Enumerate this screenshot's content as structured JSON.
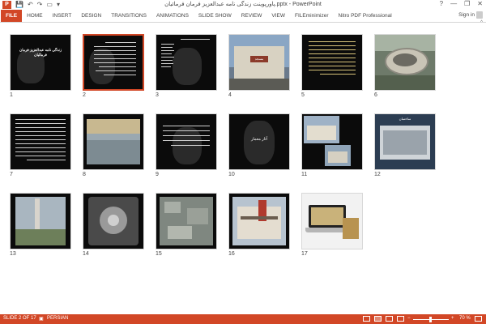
{
  "window": {
    "title": "پاورپوینت زندگی نامه عبدالعزیز فرمان فرمائیان.pptx - PowerPoint",
    "app_badge": "P",
    "qat": {
      "save": "💾",
      "undo": "↶",
      "redo": "↷",
      "start": "▭",
      "customize": "▾"
    },
    "help": "?",
    "minimize": "—",
    "restore": "❐",
    "close": "✕"
  },
  "ribbon": {
    "tabs": [
      "FILE",
      "HOME",
      "INSERT",
      "DESIGN",
      "TRANSITIONS",
      "ANIMATIONS",
      "SLIDE SHOW",
      "REVIEW",
      "VIEW",
      "FILEminimizer",
      "Nitro PDF Professional"
    ],
    "signin": "Sign in",
    "collapse": "^"
  },
  "slides": [
    {
      "n": "1"
    },
    {
      "n": "2"
    },
    {
      "n": "3"
    },
    {
      "n": "4"
    },
    {
      "n": "5"
    },
    {
      "n": "6"
    },
    {
      "n": "7"
    },
    {
      "n": "8"
    },
    {
      "n": "9"
    },
    {
      "n": "10"
    },
    {
      "n": "11"
    },
    {
      "n": "12"
    },
    {
      "n": "13"
    },
    {
      "n": "14"
    },
    {
      "n": "15"
    },
    {
      "n": "16"
    },
    {
      "n": "17"
    }
  ],
  "slide_text": {
    "s1_title": "زندگی نامه عبدالعزیز فرمان فرمائیان",
    "s4_sign": "مسجد",
    "s10_title": "آثار معمار",
    "s12_title": "ساختمان"
  },
  "statusbar": {
    "slide_info": "SLIDE 2 OF 17",
    "language": "PERSIAN",
    "zoom": "70 %",
    "zoom_minus": "−",
    "zoom_plus": "+"
  },
  "colors": {
    "accent": "#d24726",
    "thumb_bg": "#0b0b0b"
  }
}
